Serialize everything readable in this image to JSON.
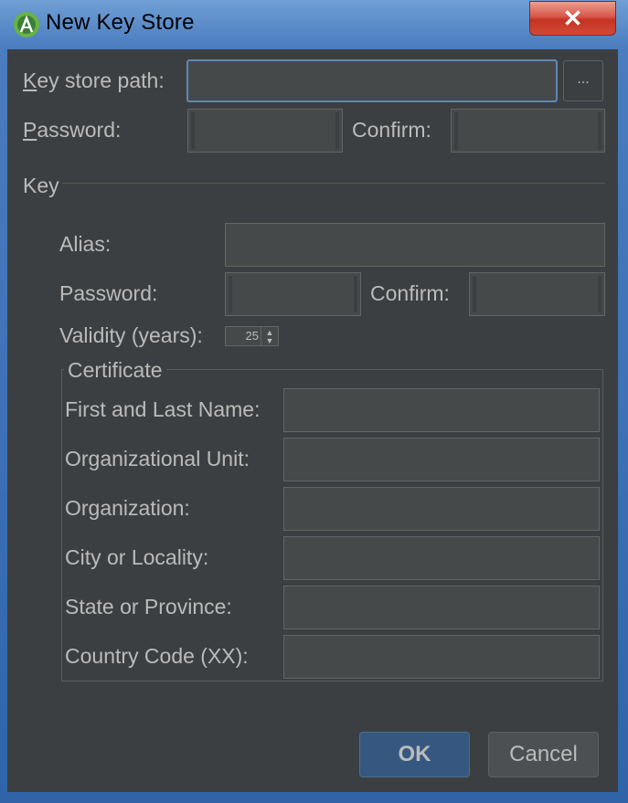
{
  "window": {
    "title": "New Key Store",
    "close_glyph": "✕",
    "app_icon": "android-studio-icon"
  },
  "keystore": {
    "path_label": "Key store path:",
    "path_value": "",
    "browse_label": "...",
    "password_label": "Password:",
    "confirm_label": "Confirm:"
  },
  "key": {
    "section_label": "Key",
    "alias_label": "Alias:",
    "password_label": "Password:",
    "confirm_label": "Confirm:",
    "validity_label": "Validity (years):",
    "validity_value": "25"
  },
  "certificate": {
    "title": "Certificate",
    "fields": [
      {
        "label": "First and Last Name:"
      },
      {
        "label": "Organizational Unit:"
      },
      {
        "label": "Organization:"
      },
      {
        "label": "City or Locality:"
      },
      {
        "label": "State or Province:"
      },
      {
        "label": "Country Code (XX):"
      }
    ]
  },
  "buttons": {
    "ok": "OK",
    "cancel": "Cancel"
  },
  "colors": {
    "background": "#3c3f41",
    "field": "#45494a",
    "accent": "#365880",
    "text": "#bbbbbb"
  }
}
